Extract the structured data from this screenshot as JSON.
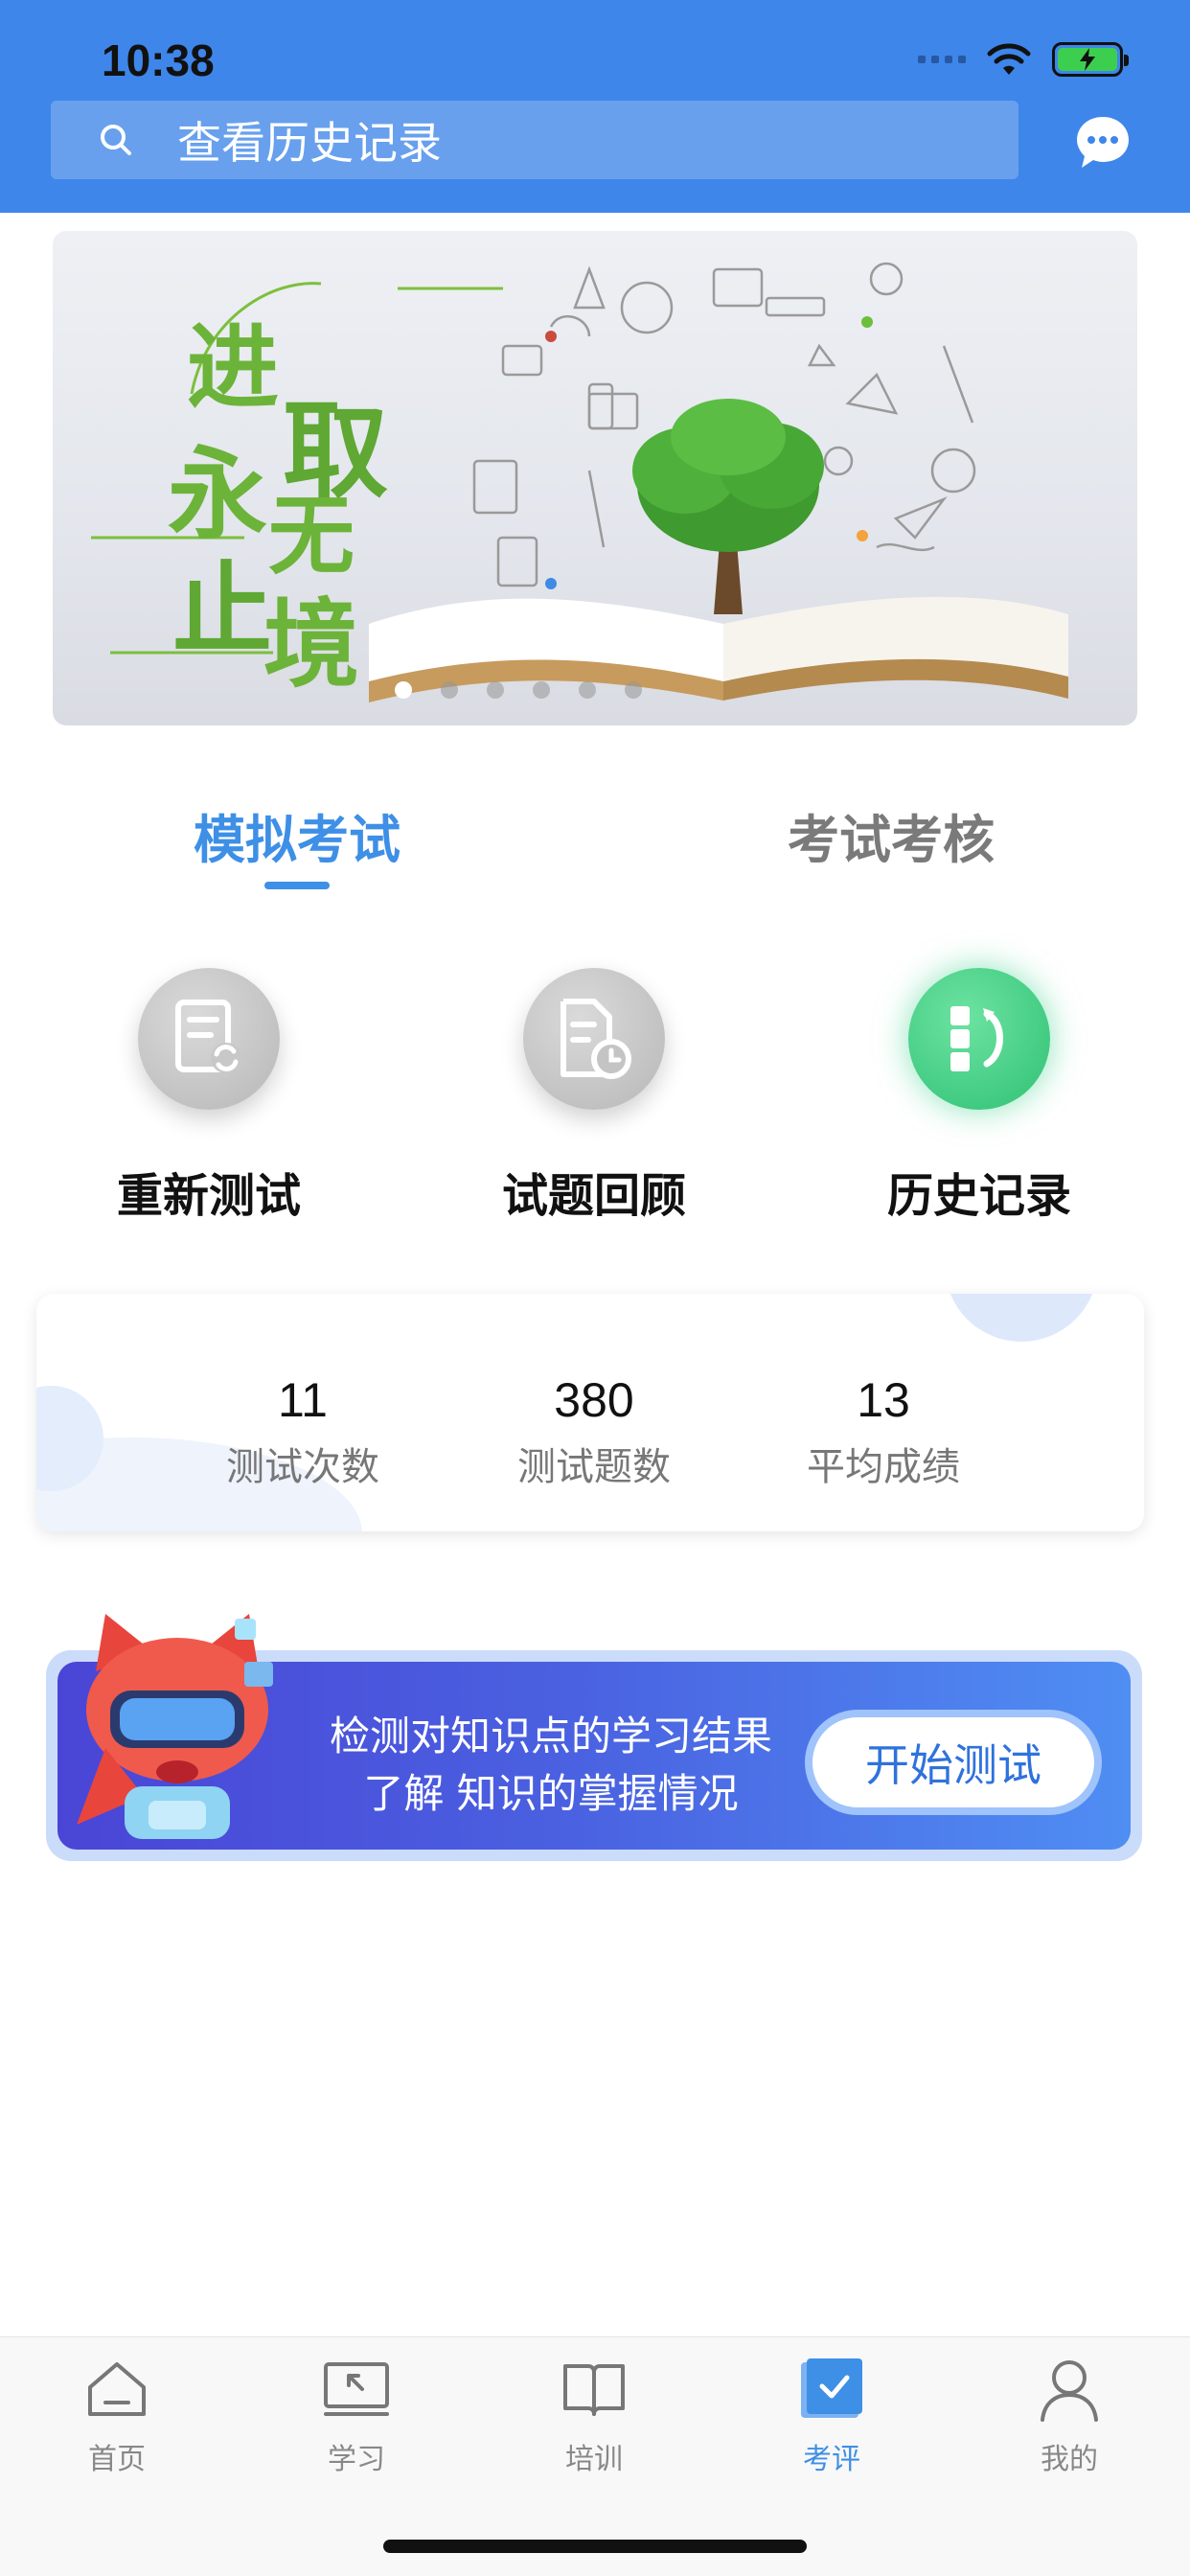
{
  "status_bar": {
    "time": "10:38"
  },
  "header": {
    "search_placeholder": "查看历史记录",
    "accent_color": "#3e86ea"
  },
  "banner": {
    "slogan": "进取永无止境",
    "slogan_chars": [
      "进",
      "取",
      "永",
      "无",
      "止",
      "境"
    ],
    "pages": 6,
    "active_page": 1
  },
  "tabs": [
    {
      "label": "模拟考试",
      "active": true
    },
    {
      "label": "考试考核",
      "active": false
    }
  ],
  "actions": [
    {
      "label": "重新测试",
      "icon": "retest-icon"
    },
    {
      "label": "试题回顾",
      "icon": "review-icon"
    },
    {
      "label": "历史记录",
      "icon": "history-icon"
    }
  ],
  "stats": [
    {
      "value": "11",
      "caption": "测试次数"
    },
    {
      "value": "380",
      "caption": "测试题数"
    },
    {
      "value": "13",
      "caption": "平均成绩"
    }
  ],
  "promo": {
    "line1": "检测对知识点的学习结果",
    "line2": "了解 知识的掌握情况",
    "button": "开始测试"
  },
  "tabbar": [
    {
      "label": "首页",
      "icon": "home-icon",
      "active": false
    },
    {
      "label": "学习",
      "icon": "study-icon",
      "active": false
    },
    {
      "label": "培训",
      "icon": "book-icon",
      "active": false
    },
    {
      "label": "考评",
      "icon": "check-icon",
      "active": true
    },
    {
      "label": "我的",
      "icon": "person-icon",
      "active": false
    }
  ]
}
